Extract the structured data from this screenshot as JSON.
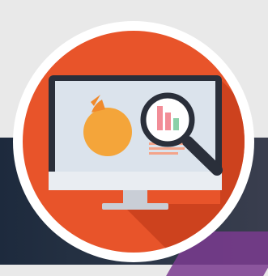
{
  "icon": {
    "name": "analytics-monitor-icon",
    "elements": [
      "monitor-icon",
      "pie-chart-icon",
      "magnifier-icon",
      "bar-chart-icon",
      "text-lines-icon"
    ]
  },
  "colors": {
    "background_light": "#e9e9e9",
    "background_dark": "#1d2a3d",
    "accent_purple": "#7a3b8f",
    "ring": "#ffffff",
    "circle": "#e8542a",
    "shadow": "#c8401c",
    "monitor_frame": "#2a2f3a",
    "screen": "#dbe3ec",
    "pie": "#f4a53a",
    "pie_slice": "#f08a2c",
    "bar_pink": "#f28d97",
    "bar_green": "#8bd0a8",
    "stand": "#c9ced6",
    "text_lines": "#f4a48a"
  }
}
